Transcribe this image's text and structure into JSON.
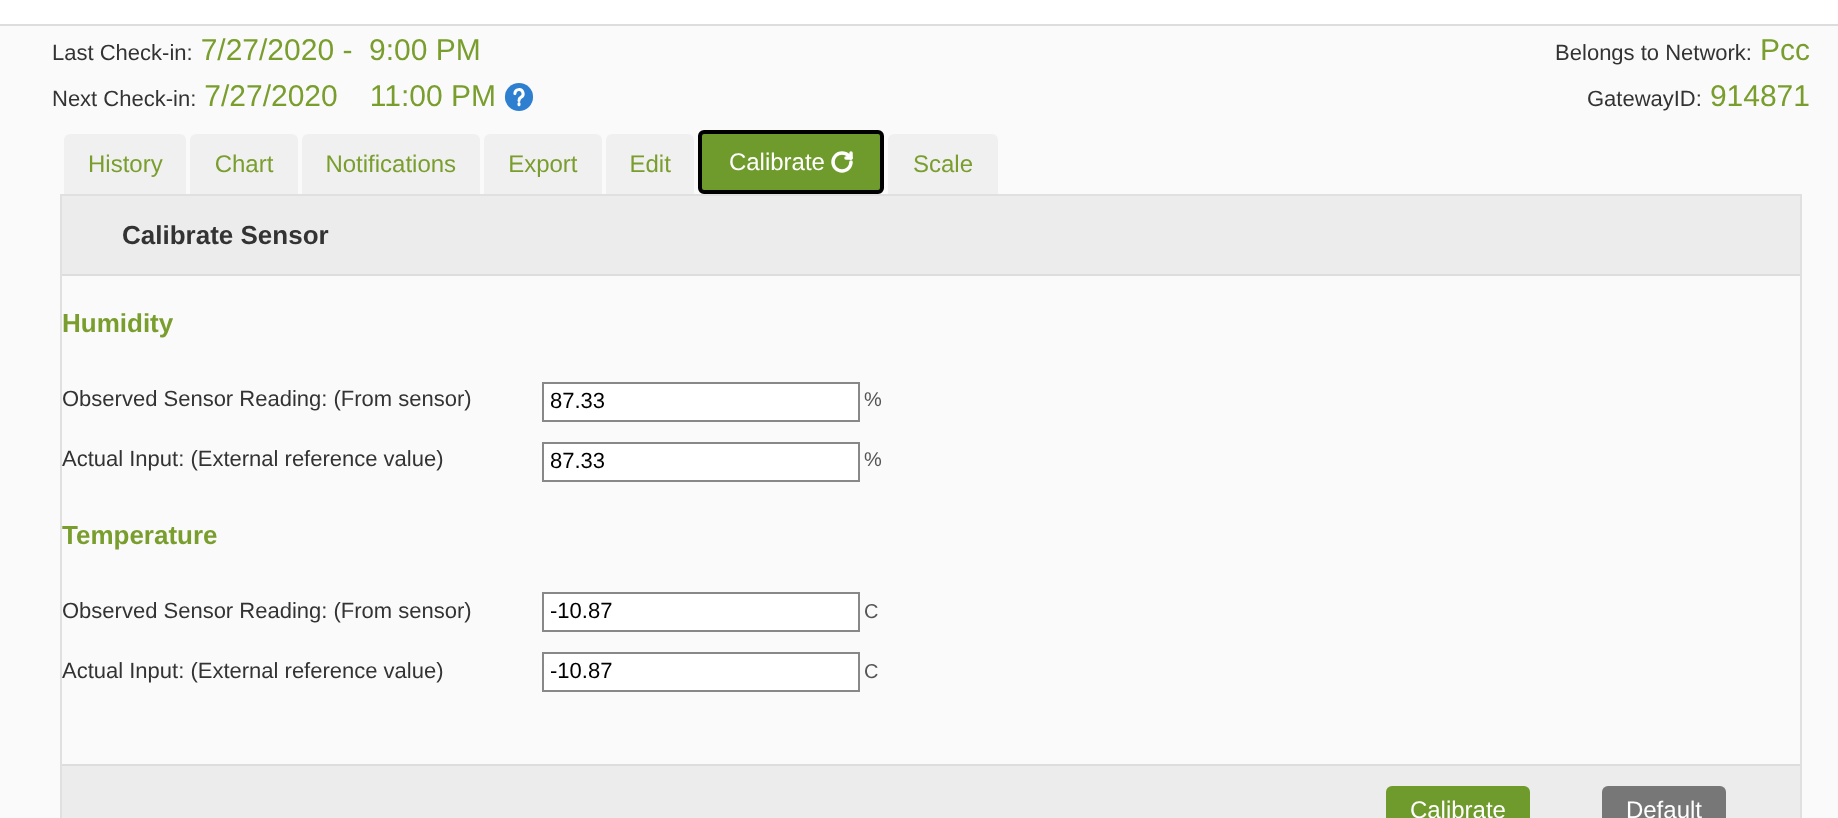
{
  "header": {
    "last_checkin_label": "Last Check-in:",
    "last_checkin_value": "7/27/2020 -  9:00 PM",
    "next_checkin_label": "Next Check-in:",
    "next_checkin_date": "7/27/2020",
    "next_checkin_time": "11:00 PM",
    "network_label": "Belongs to Network:",
    "network_value": "Pcc",
    "gateway_label": "GatewayID:",
    "gateway_value": "914871"
  },
  "tabs": [
    {
      "label": "History",
      "selected": false
    },
    {
      "label": "Chart",
      "selected": false
    },
    {
      "label": "Notifications",
      "selected": false
    },
    {
      "label": "Export",
      "selected": false
    },
    {
      "label": "Edit",
      "selected": false
    },
    {
      "label": "Calibrate",
      "selected": true
    },
    {
      "label": "Scale",
      "selected": false
    }
  ],
  "panel": {
    "title": "Calibrate Sensor",
    "sections": [
      {
        "title": "Humidity",
        "fields": [
          {
            "label": "Observed Sensor Reading: (From sensor)",
            "value": "87.33",
            "unit": "%"
          },
          {
            "label": "Actual Input: (External reference value)",
            "value": "87.33",
            "unit": "%"
          }
        ]
      },
      {
        "title": "Temperature",
        "fields": [
          {
            "label": "Observed Sensor Reading: (From sensor)",
            "value": "-10.87",
            "unit": "C"
          },
          {
            "label": "Actual Input: (External reference value)",
            "value": "-10.87",
            "unit": "C"
          }
        ]
      }
    ],
    "buttons": [
      {
        "label": "Calibrate",
        "kind": "primary"
      },
      {
        "label": "Default",
        "kind": "secondary"
      }
    ]
  }
}
